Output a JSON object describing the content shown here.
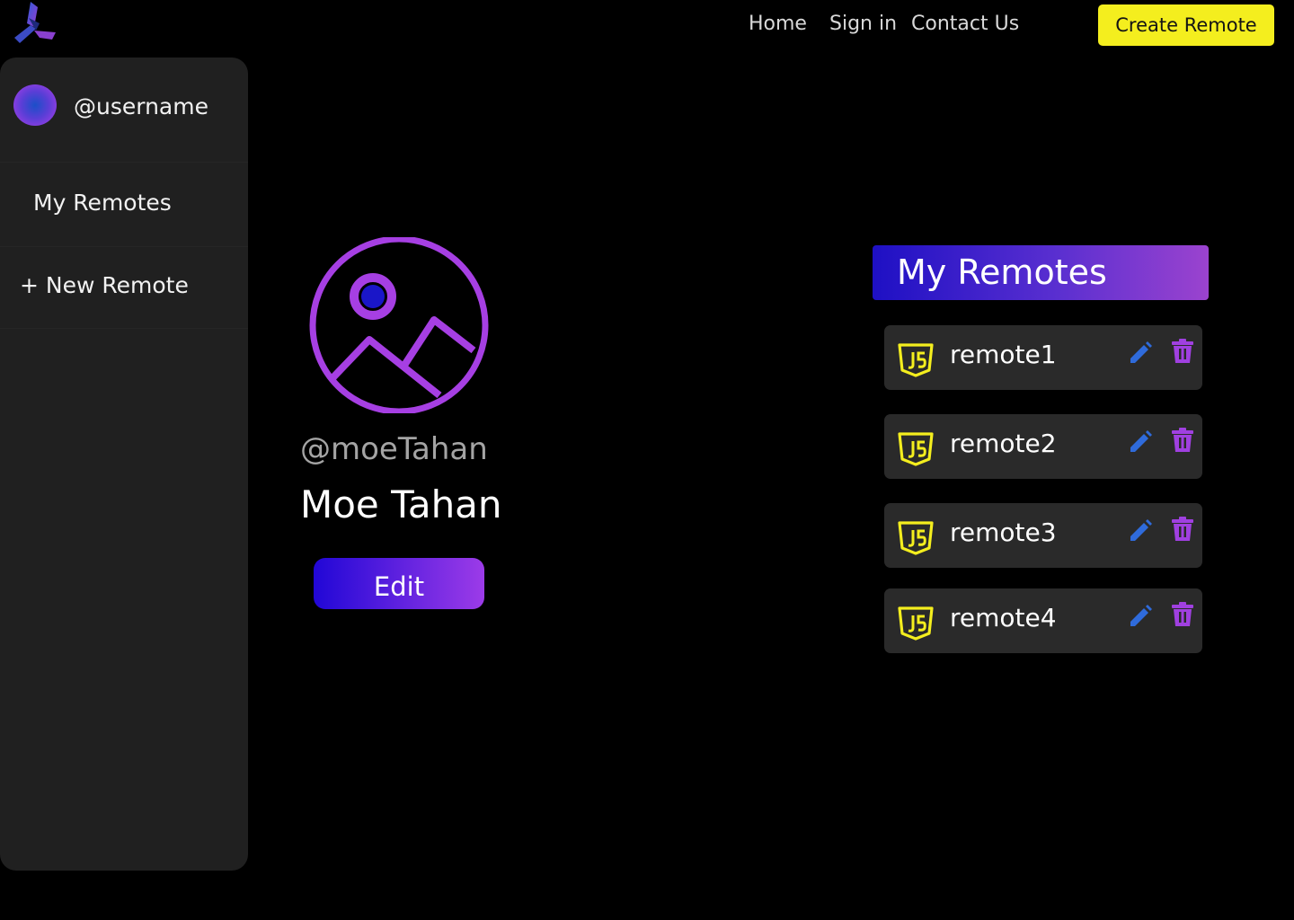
{
  "nav": {
    "home": "Home",
    "sign_in": "Sign in",
    "contact": "Contact Us",
    "create_remote": "Create Remote"
  },
  "sidebar": {
    "username": "@username",
    "items": [
      {
        "label": "My Remotes"
      },
      {
        "label": "+ New Remote"
      }
    ]
  },
  "profile": {
    "handle": "@moeTahan",
    "name": "Moe Tahan",
    "edit_label": "Edit"
  },
  "remotes": {
    "header": "My Remotes",
    "items": [
      {
        "name": "remote1",
        "icon": "js-icon"
      },
      {
        "name": "remote2",
        "icon": "js-icon"
      },
      {
        "name": "remote3",
        "icon": "js-icon"
      },
      {
        "name": "remote4",
        "icon": "js-icon"
      }
    ]
  },
  "colors": {
    "accent_yellow": "#f4ee1e",
    "accent_purple": "#9c3be8",
    "accent_blue": "#2107d6",
    "pen_blue": "#2f6bdb",
    "trash_purple": "#a040e0"
  }
}
